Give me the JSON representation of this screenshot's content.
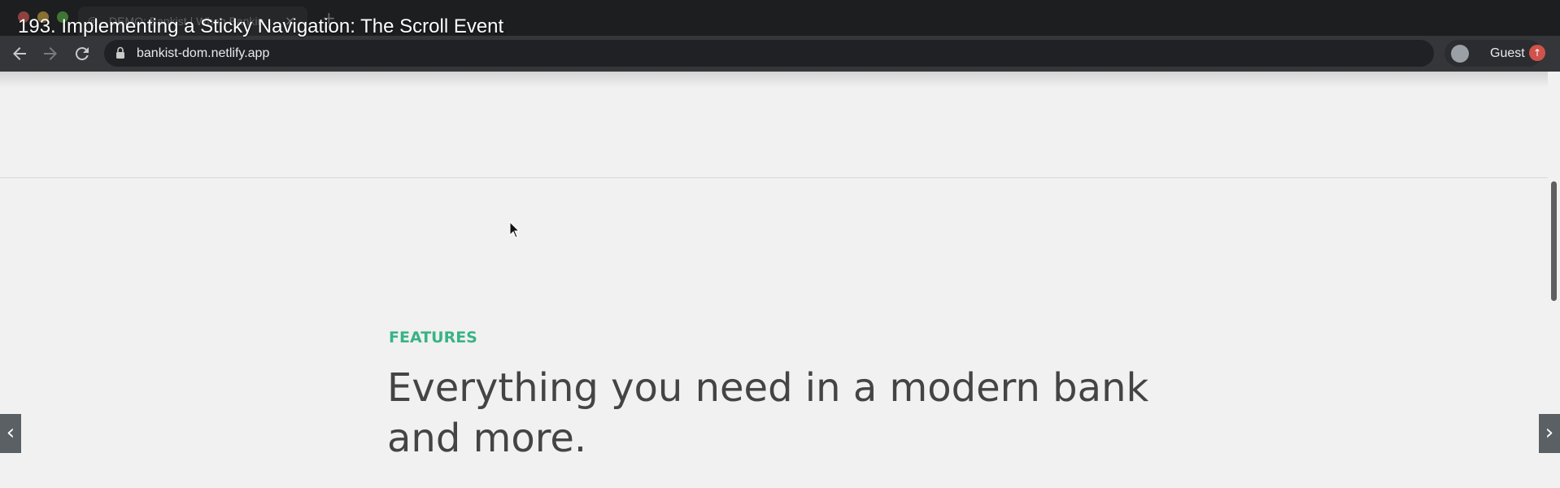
{
  "browser": {
    "tab_title": "DEMO: Bankist | When Bankin",
    "tab_close": "×",
    "new_tab": "+",
    "url": "bankist-dom.netlify.app",
    "profile_label": "Guest",
    "icons": {
      "back": "back-arrow-icon",
      "forward": "forward-arrow-icon",
      "reload": "reload-icon",
      "lock": "lock-icon",
      "profile": "profile-avatar-icon",
      "extension": "update-icon"
    }
  },
  "overlay": {
    "title": "193. Implementing a Sticky Navigation: The Scroll Event"
  },
  "page": {
    "section_label": "FEATURES",
    "section_title": "Everything you need in a modern bank and more.",
    "colors": {
      "accent": "#39b385",
      "heading": "#444444",
      "background": "#f1f1f1"
    }
  },
  "controls": {
    "prev_arrow": "‹",
    "next_arrow": "›"
  }
}
